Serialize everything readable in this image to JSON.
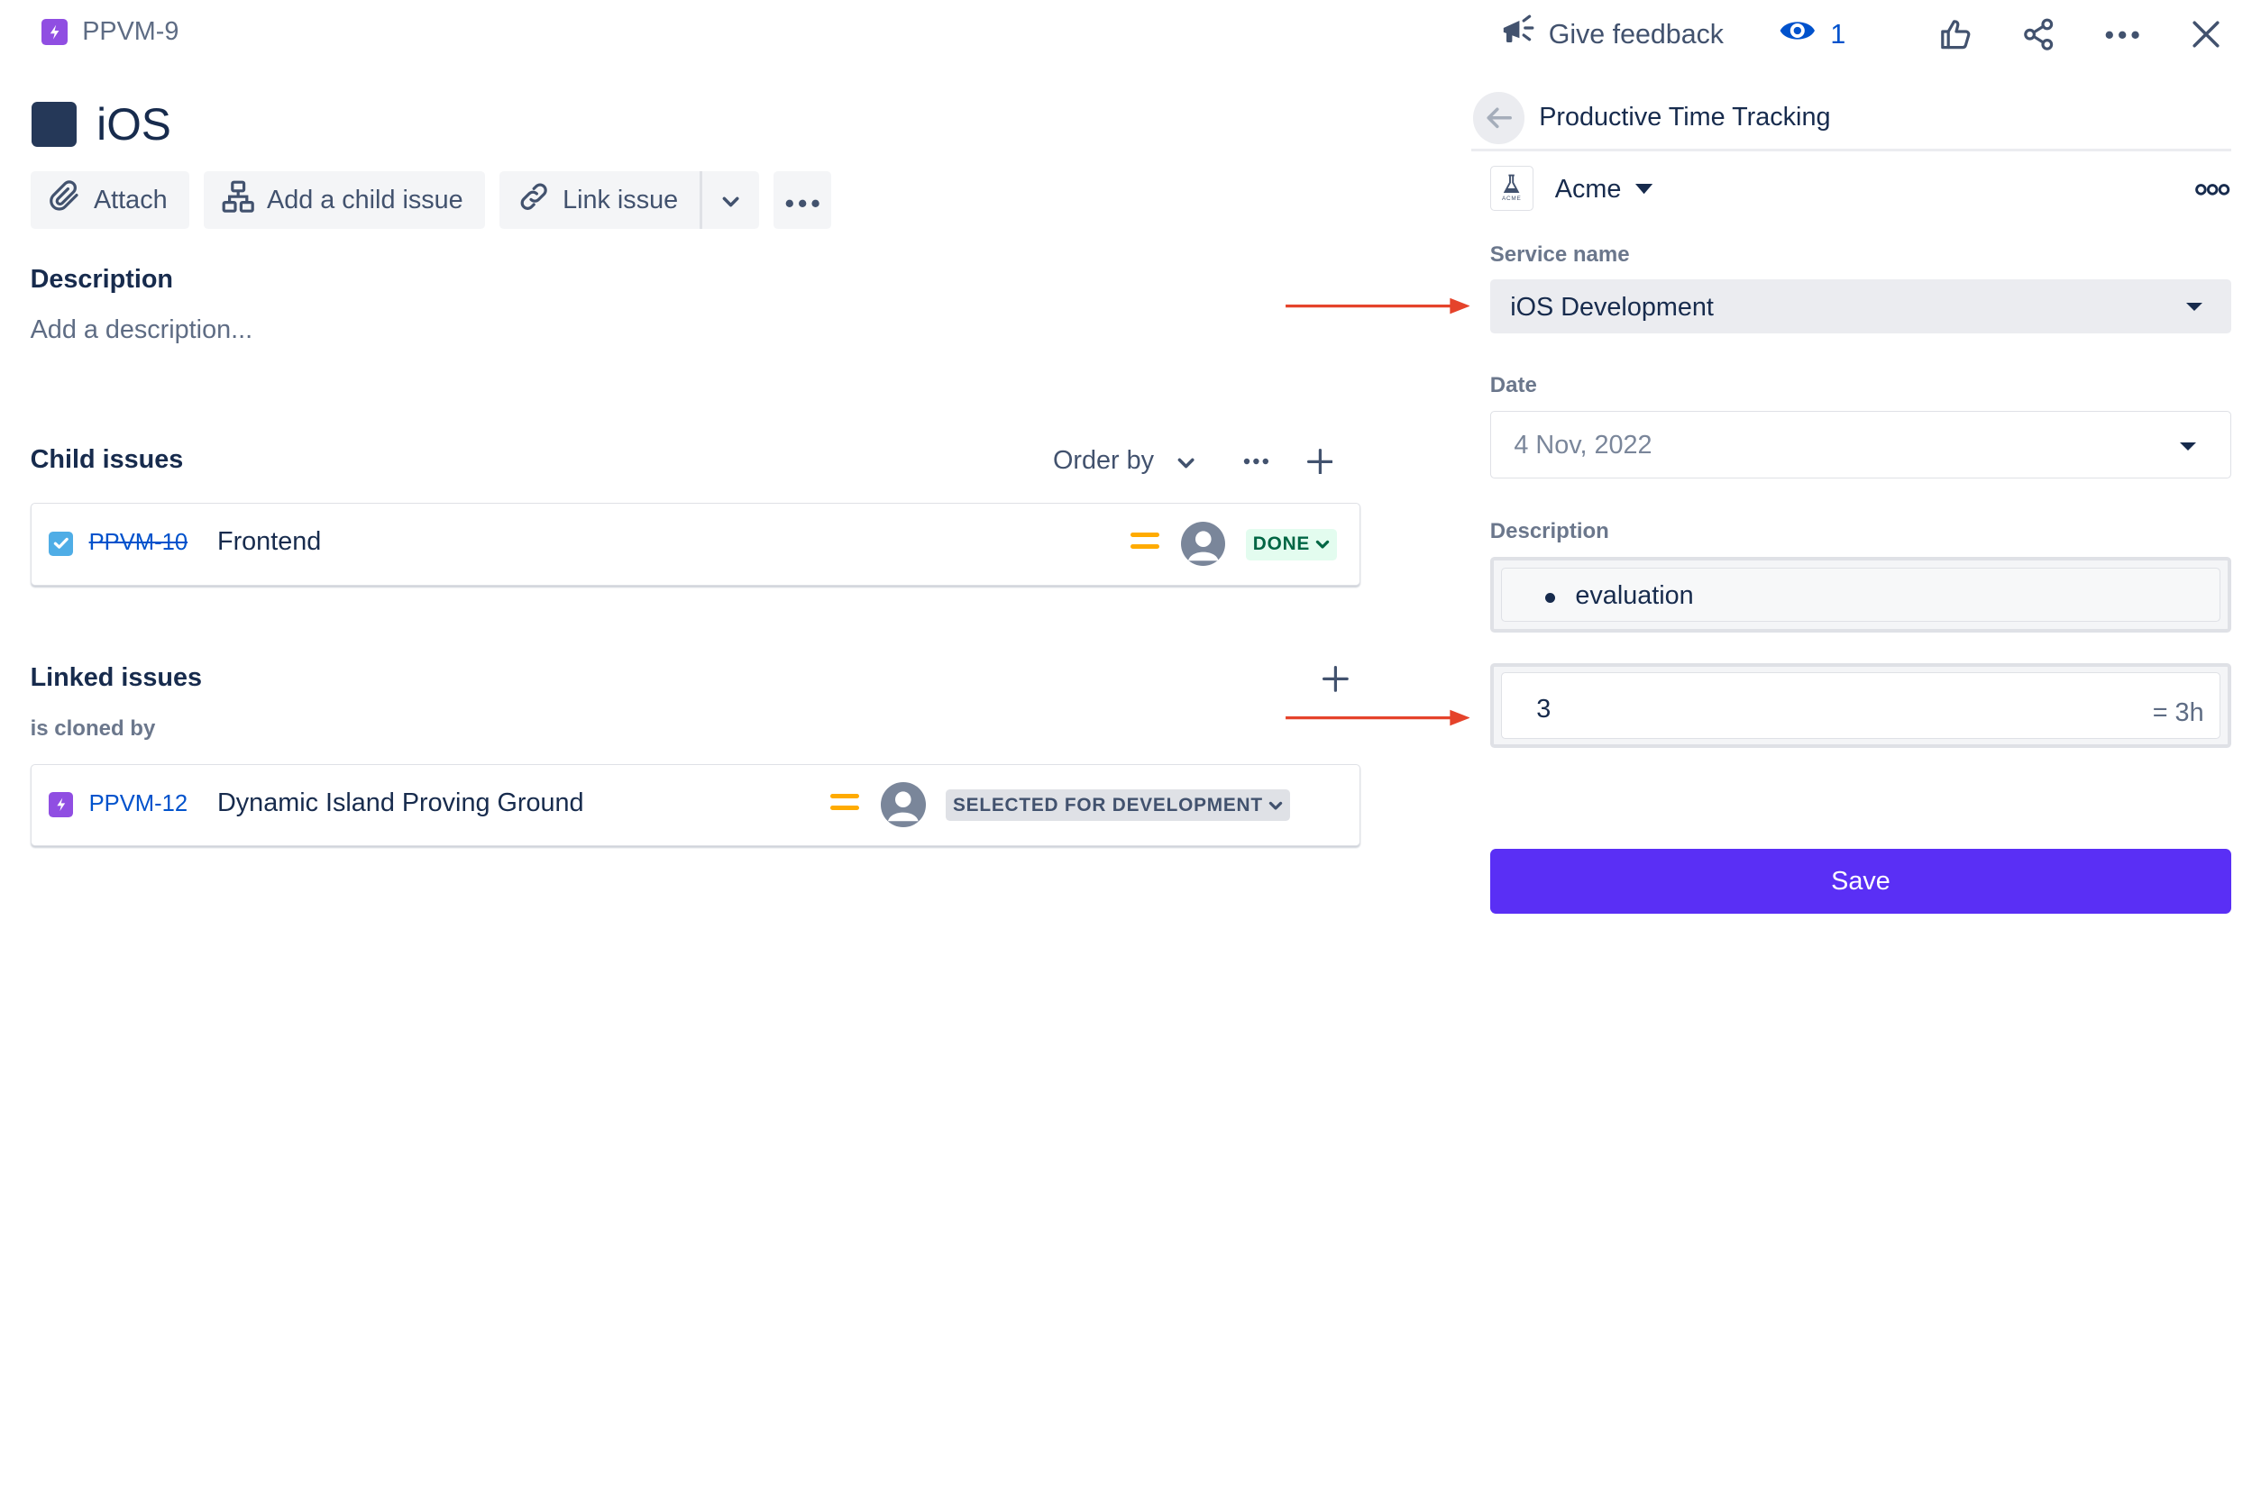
{
  "topbar": {
    "issue_key": "PPVM-9",
    "feedback_label": "Give feedback",
    "watchers_count": "1"
  },
  "issue": {
    "title": "iOS",
    "toolbar": {
      "attach_label": "Attach",
      "add_child_label": "Add a child issue",
      "link_issue_label": "Link issue"
    },
    "description": {
      "heading": "Description",
      "placeholder": "Add a description..."
    },
    "child_issues": {
      "heading": "Child issues",
      "order_by_label": "Order by",
      "items": [
        {
          "key": "PPVM-10",
          "summary": "Frontend",
          "status": "DONE",
          "priority": "medium",
          "type": "subtask",
          "key_struck": true
        }
      ]
    },
    "linked_issues": {
      "heading": "Linked issues",
      "relation_label": "is cloned by",
      "items": [
        {
          "key": "PPVM-12",
          "summary": "Dynamic Island Proving Ground",
          "status": "SELECTED FOR DEVELOPMENT",
          "priority": "medium",
          "type": "epic"
        }
      ]
    }
  },
  "panel": {
    "title": "Productive Time Tracking",
    "organization": "Acme",
    "logo_text": "ACME",
    "service_name_label": "Service name",
    "service_name_value": "iOS Development",
    "date_label": "Date",
    "date_value": "4 Nov, 2022",
    "description_label": "Description",
    "description_bullet": "evaluation",
    "time_value": "3",
    "time_suffix": "= 3h",
    "save_label": "Save"
  },
  "colors": {
    "accent": "#5a2ff5",
    "link": "#0052cc",
    "annotation_arrow": "#e5432b",
    "epic_purple": "#904ee2",
    "subtask_blue": "#4fade6",
    "priority_medium": "#ffab00",
    "done_bg": "#e3fcef",
    "done_text": "#006644"
  },
  "icons": [
    "lightning-icon",
    "megaphone-icon",
    "eye-icon",
    "thumbs-up-icon",
    "share-icon",
    "more-icon",
    "close-icon",
    "paperclip-icon",
    "hierarchy-icon",
    "link-icon",
    "chevron-down-icon",
    "plus-icon",
    "checkbox-icon",
    "priority-medium-icon",
    "avatar-icon",
    "arrow-left-icon",
    "caret-down-icon"
  ]
}
